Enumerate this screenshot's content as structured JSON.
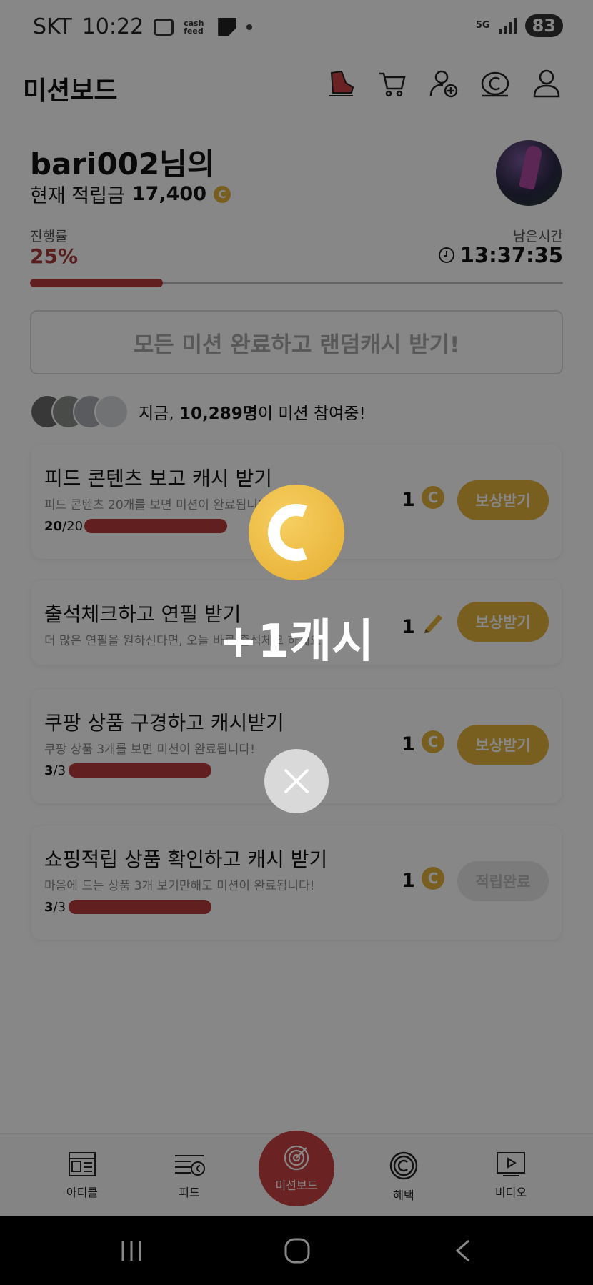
{
  "status_bar": {
    "carrier": "SKT",
    "time": "10:22",
    "cashfeed_label": "cash feed",
    "network": "5G",
    "battery": "83"
  },
  "header": {
    "title": "미션보드",
    "icons": [
      "shoe-icon",
      "cart-icon",
      "add-user-icon",
      "cash-c-icon",
      "profile-icon"
    ]
  },
  "profile": {
    "username": "bari002님의",
    "balance_label": "현재 적립금",
    "balance_value": "17,400",
    "coin_symbol": "C"
  },
  "progress": {
    "label": "진행률",
    "value": "25%",
    "fraction": 0.25,
    "time_label": "남은시간",
    "time_value": "13:37:35"
  },
  "all_missions_button": "모든 미션 완료하고 랜덤캐시 받기!",
  "participants": {
    "prefix": "지금, ",
    "count": "10,289명",
    "suffix": "이 미션 참여중!"
  },
  "missions": [
    {
      "title": "피드 콘텐츠 보고 캐시 받기",
      "desc": "피드 콘텐츠 20개를 보면 미션이 완료됩니다!",
      "done": "20",
      "total": "/20",
      "fraction": 1.0,
      "reward": "1",
      "reward_icon": "coin-icon",
      "button": "보상받기",
      "completed": false
    },
    {
      "title": "출석체크하고 연필 받기",
      "desc": "더 많은 연필을 원하신다면, 오늘 바로 출석체크 하세요!",
      "reward": "1",
      "reward_icon": "pencil-icon",
      "button": "보상받기",
      "completed": false
    },
    {
      "title": "쿠팡 상품 구경하고 캐시받기",
      "desc": "쿠팡 상품 3개를 보면 미션이 완료됩니다!",
      "done": "3",
      "total": "/3",
      "fraction": 1.0,
      "reward": "1",
      "reward_icon": "coin-icon",
      "button": "보상받기",
      "completed": false
    },
    {
      "title": "쇼핑적립 상품 확인하고 캐시 받기",
      "desc": "마음에 드는 상품 3개 보기만해도 미션이 완료됩니다!",
      "done": "3",
      "total": "/3",
      "fraction": 1.0,
      "reward": "1",
      "reward_icon": "coin-icon",
      "button": "적립완료",
      "completed": true
    }
  ],
  "popup": {
    "text": "+1캐시",
    "icon": "cash-coin-icon",
    "close_icon": "close-icon"
  },
  "bottom_nav": [
    {
      "label": "아티클",
      "icon": "article-icon"
    },
    {
      "label": "피드",
      "icon": "feed-icon"
    },
    {
      "label": "미션보드",
      "icon": "target-icon",
      "active": true
    },
    {
      "label": "혜택",
      "icon": "benefit-c-icon"
    },
    {
      "label": "비디오",
      "icon": "video-icon"
    }
  ],
  "colors": {
    "accent_red": "#b73c3c",
    "coin_gold": "#e3b23c",
    "overlay": "rgba(0,0,0,0.47)"
  }
}
